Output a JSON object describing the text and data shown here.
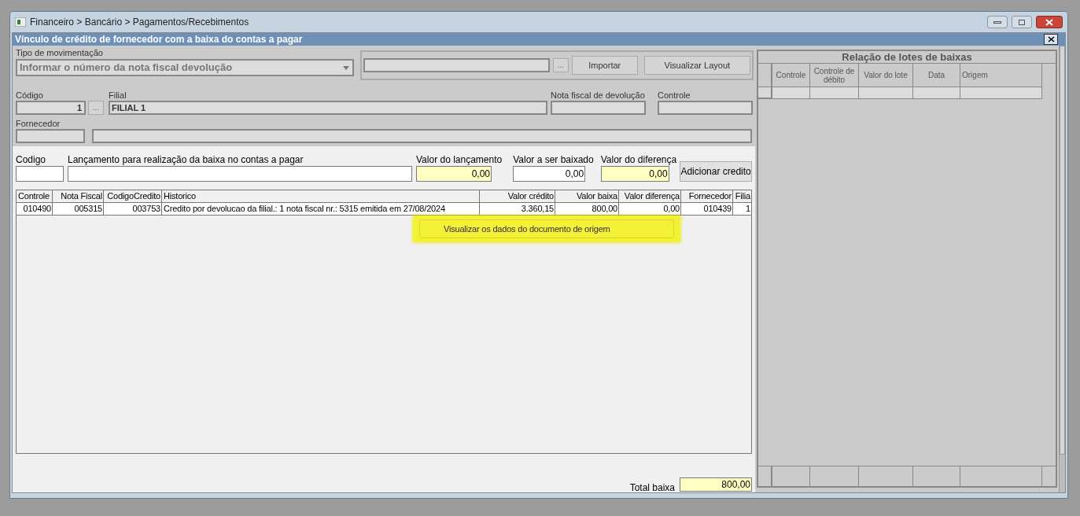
{
  "window": {
    "title": "Financeiro > Bancário > Pagamentos/Recebimentos"
  },
  "form": {
    "title": "Vínculo de crédito de fornecedor com a baixa do contas a pagar"
  },
  "tipo_movimentacao": {
    "label": "Tipo de  movimentação",
    "value": "Informar o número da nota fiscal devolução"
  },
  "import": {
    "browse": "...",
    "buttons": [
      "Importar",
      "Visualizar Layout"
    ]
  },
  "codigo": {
    "label": "Código",
    "value": "1",
    "browse": "..."
  },
  "filial": {
    "label": "Filial",
    "value": "FILIAL 1"
  },
  "nota_fiscal_devolucao": {
    "label": "Nota fiscal de devolução"
  },
  "controle": {
    "label": "Controle"
  },
  "fornecedor": {
    "label": "Fornecedor"
  },
  "entry_fields": [
    {
      "label": "Codigo",
      "highlighted": false
    },
    {
      "label": "Lançamento para realização da baixa no contas a pagar",
      "highlighted": false
    },
    {
      "label": "Valor do lançamento",
      "value": "0,00",
      "highlighted": true
    },
    {
      "label": "Valor a ser baixado",
      "value": "0,00",
      "highlighted": false
    },
    {
      "label": "Valor do diferença",
      "value": "0,00",
      "highlighted": true
    }
  ],
  "add_button": "Adicionar credito",
  "grid": {
    "columns": [
      "Controle",
      "Nota Fiscal",
      "CodigoCredito",
      "Historico",
      "Valor crédito",
      "Valor baixa",
      "Valor diferença",
      "Fornecedor",
      "Filia"
    ],
    "rows": [
      [
        "010490",
        "005315",
        "003753",
        "Credito por devolucao da filial.: 1 nota fiscal  nr.: 5315 emitida em 27/08/2024",
        "3.360,15",
        "800,00",
        "0,00",
        "010439",
        "1"
      ]
    ]
  },
  "context_tooltip": "Visualizar os dados do documento de origem",
  "total": {
    "label": "Total baixa",
    "value": "800,00"
  },
  "lotes": {
    "title": "Relação de lotes de baixas",
    "columns": [
      "Controle",
      "Controle de débito",
      "Valor do lote",
      "Data",
      "Origem"
    ]
  }
}
